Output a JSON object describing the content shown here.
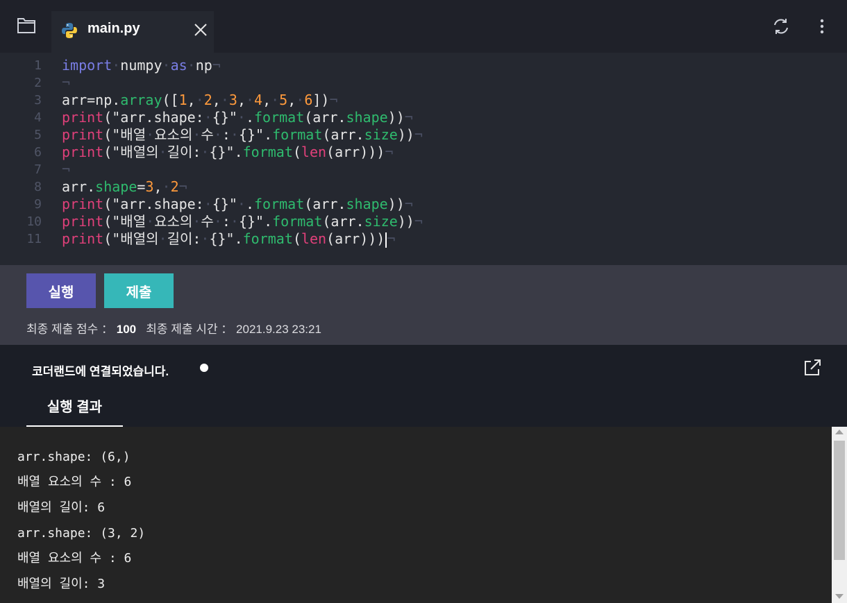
{
  "tab": {
    "filename": "main.py"
  },
  "editor": {
    "lines": [
      {
        "n": "1"
      },
      {
        "n": "2"
      },
      {
        "n": "3"
      },
      {
        "n": "4"
      },
      {
        "n": "5"
      },
      {
        "n": "6"
      },
      {
        "n": "7"
      },
      {
        "n": "8"
      },
      {
        "n": "9"
      },
      {
        "n": "10"
      },
      {
        "n": "11"
      }
    ],
    "source": [
      "import numpy as np",
      "",
      "arr=np.array([1, 2, 3, 4, 5, 6])",
      "print(\"arr.shape: {}\" .format(arr.shape))",
      "print(\"배열 요소의 수 : {}\".format(arr.size))",
      "print(\"배열의 길이: {}\".format(len(arr)))",
      "",
      "arr.shape=3, 2",
      "print(\"arr.shape: {}\" .format(arr.shape))",
      "print(\"배열 요소의 수 : {}\".format(arr.size))",
      "print(\"배열의 길이: {}\".format(len(arr)))"
    ]
  },
  "controls": {
    "run_label": "실행",
    "submit_label": "제출",
    "score_label": "최종 제출 점수 ：",
    "score_value": "100",
    "time_label": "최종 제출 시간 ：",
    "time_value": "2021.9.23 23:21"
  },
  "status": {
    "connection_text": "코더랜드에 연결되었습니다."
  },
  "results": {
    "tab_label": "실행 결과",
    "lines": [
      "arr.shape: (6,)",
      "배열 요소의 수 : 6",
      "배열의 길이: 6",
      "arr.shape: (3, 2)",
      "배열 요소의 수 : 6",
      "배열의 길이: 3"
    ]
  },
  "colors": {
    "keyword": "#7a7ee6",
    "function": "#e0407a",
    "number": "#ff9a3c",
    "attribute": "#2fbb6e",
    "run_button": "#5755ad",
    "submit_button": "#36b7b8"
  },
  "icons": [
    "folder-icon",
    "python-icon",
    "close-icon",
    "refresh-icon",
    "more-icon",
    "external-link-icon"
  ]
}
